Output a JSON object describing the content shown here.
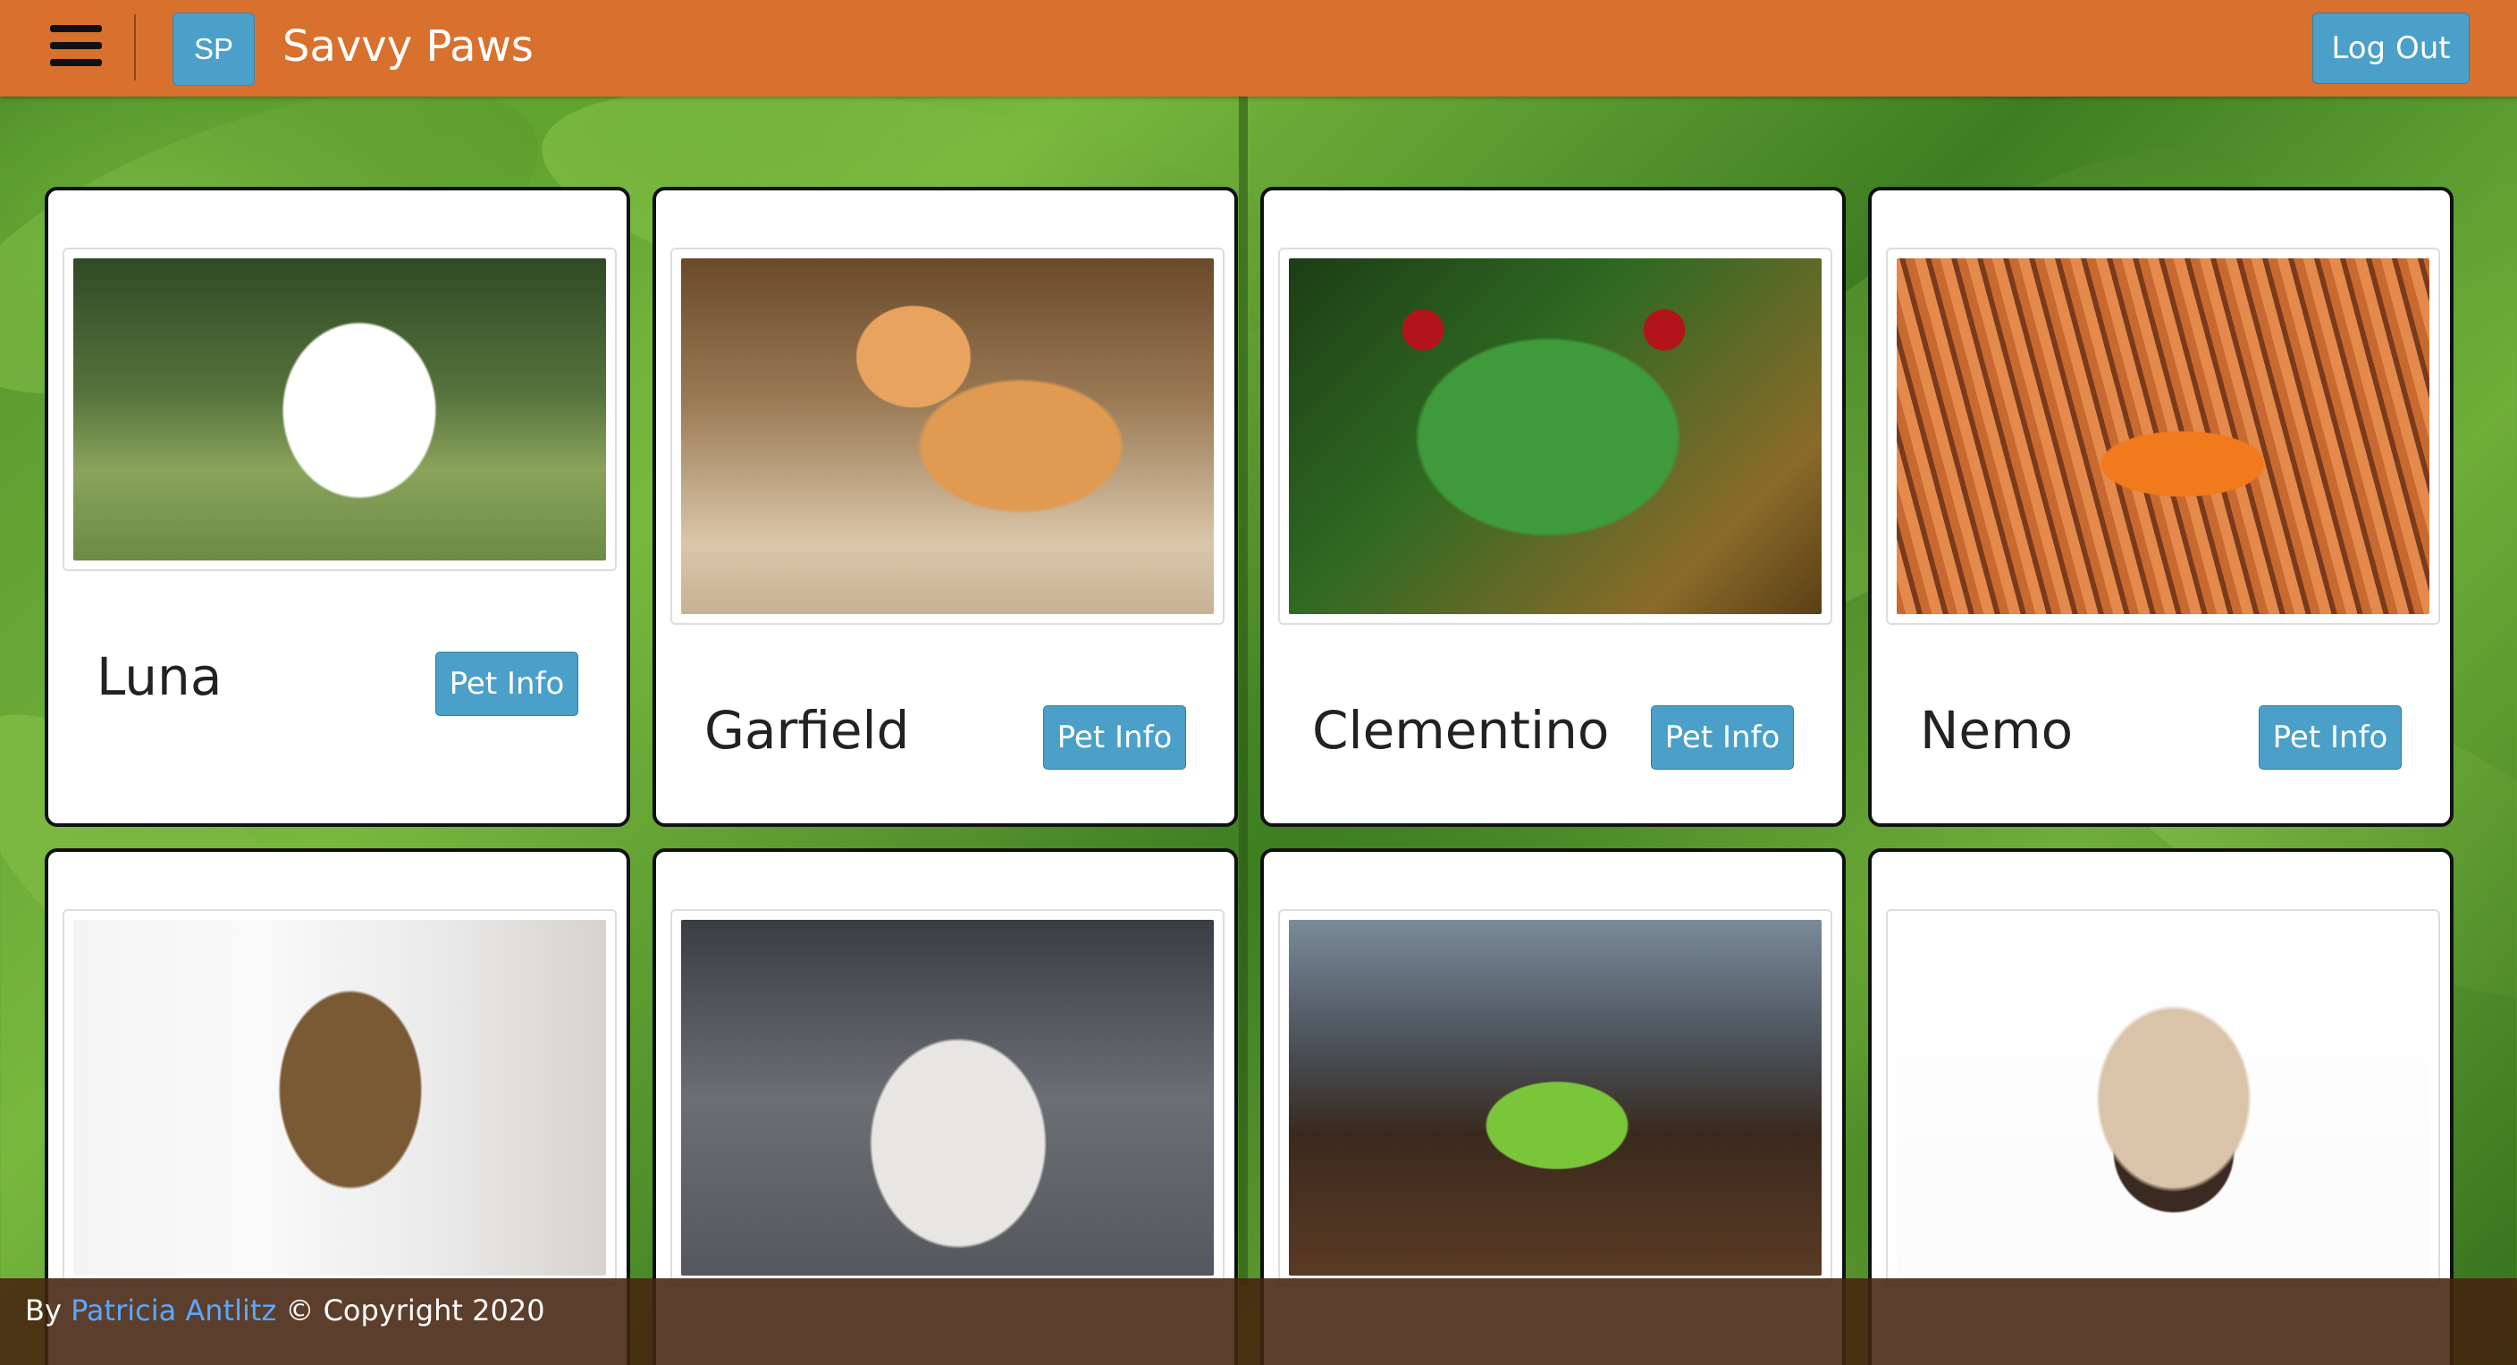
{
  "header": {
    "menu_icon": "hamburger-menu-icon",
    "logo_initials": "SP",
    "app_title": "Savvy Paws",
    "logout_label": "Log Out",
    "bar_color": "#d9712e",
    "button_color": "#4aa0c8"
  },
  "pets": [
    {
      "name": "Luna",
      "button_label": "Pet Info",
      "photo": "white-dog-photo"
    },
    {
      "name": "Garfield",
      "button_label": "Pet Info",
      "photo": "orange-cat-photo"
    },
    {
      "name": "Clementino",
      "button_label": "Pet Info",
      "photo": "red-eyed-frog-photo"
    },
    {
      "name": "Nemo",
      "button_label": "Pet Info",
      "photo": "clownfish-photo"
    },
    {
      "name": "",
      "button_label": "",
      "photo": "yorkie-dog-photo"
    },
    {
      "name": "",
      "button_label": "",
      "photo": "tabby-white-cat-photo"
    },
    {
      "name": "",
      "button_label": "",
      "photo": "green-frog-photo"
    },
    {
      "name": "",
      "button_label": "",
      "photo": "siamese-cat-photo"
    }
  ],
  "footer": {
    "prefix": "By ",
    "author": "Patricia Antlitz",
    "suffix": " © Copyright 2020",
    "link_color": "#5aa8ff"
  }
}
